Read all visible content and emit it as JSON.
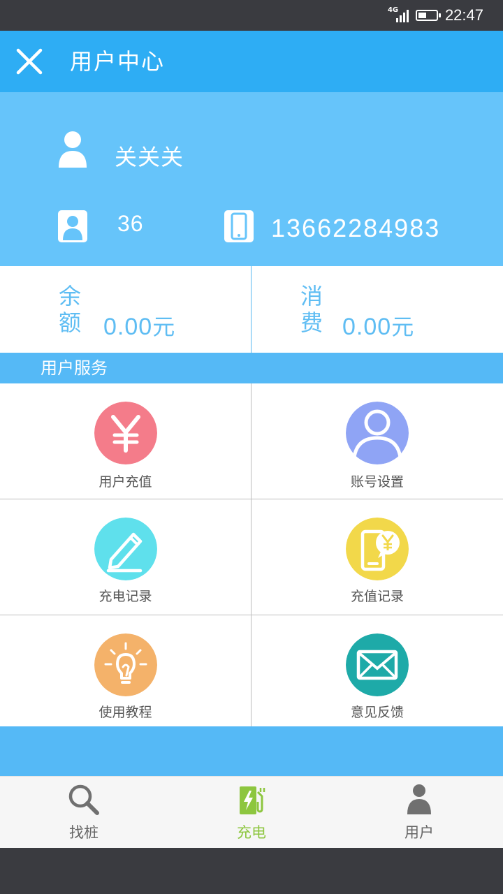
{
  "status_bar": {
    "network": "4G",
    "time": "22:47",
    "battery_level": 0.45
  },
  "header": {
    "title": "用户中心",
    "close_icon": "close-icon"
  },
  "profile": {
    "name": "关关关",
    "id": "36",
    "phone": "13662284983"
  },
  "balance": {
    "balance_label_1": "余",
    "balance_label_2": "额",
    "balance_value": "0.00",
    "balance_unit": "元",
    "consume_label_1": "消",
    "consume_label_2": "费",
    "consume_value": "0.00",
    "consume_unit": "元"
  },
  "services": {
    "title": "用户服务",
    "items": [
      {
        "label": "用户充值",
        "icon": "yuan-icon",
        "color": "#f47c8a"
      },
      {
        "label": "账号设置",
        "icon": "account-icon",
        "color": "#8fa4f5"
      },
      {
        "label": "充电记录",
        "icon": "pencil-icon",
        "color": "#5fe0ec"
      },
      {
        "label": "充值记录",
        "icon": "phone-yuan-icon",
        "color": "#f2d84a"
      },
      {
        "label": "使用教程",
        "icon": "lightbulb-icon",
        "color": "#f4b26a"
      },
      {
        "label": "意见反馈",
        "icon": "envelope-icon",
        "color": "#1eaaa8"
      }
    ]
  },
  "bottom_nav": {
    "items": [
      {
        "label": "找桩",
        "icon": "search-icon"
      },
      {
        "label": "充电",
        "icon": "charging-icon",
        "active": true
      },
      {
        "label": "用户",
        "icon": "user-icon"
      }
    ]
  },
  "colors": {
    "header": "#2eadf4",
    "profile": "#66c4fa",
    "section": "#55b9f6",
    "accent_text": "#5fbdf3",
    "active_nav": "#8dc63f"
  }
}
